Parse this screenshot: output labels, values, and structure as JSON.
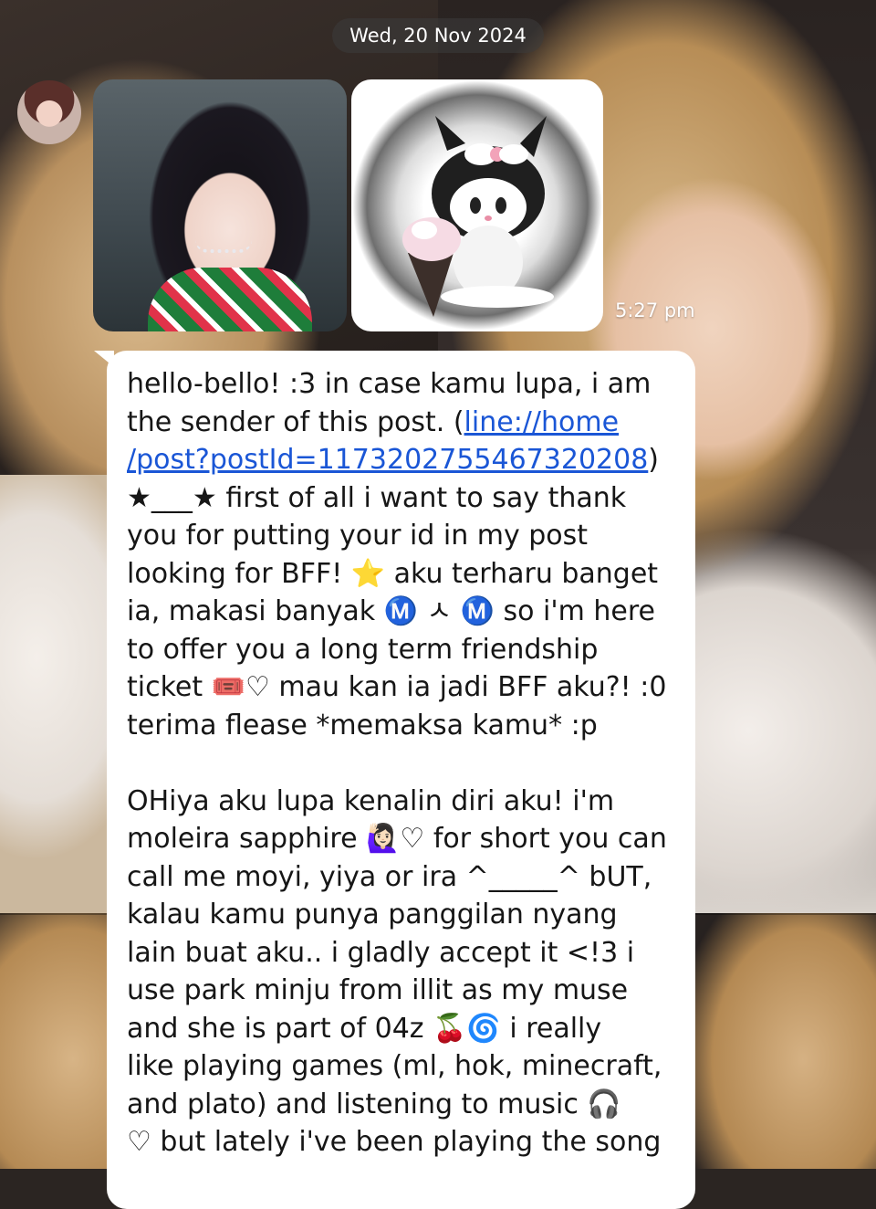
{
  "chat": {
    "date_label": "Wed, 20 Nov 2024",
    "message_time": "5:27 pm"
  },
  "message": {
    "line_1": "hello-bello! :3 in case kamu lupa, i am",
    "line_2_pre": "the sender of this post. (",
    "link_part_1": "line://home",
    "link_part_2": "/post?postId=1173202755467320208",
    "link_close": ")",
    "line_4": "★___★ first of all i want to say thank",
    "line_5": "you for putting your id in my post",
    "line_6": "looking for BFF! ⭐ aku terharu banget",
    "line_7": "ia, makasi banyak Ⓜ️ ㅅ Ⓜ️ so i'm here",
    "line_8": "to offer you a long term friendship",
    "line_9": "ticket 🎟️♡ mau kan ia jadi BFF aku?! :0",
    "line_10": "terima flease *memaksa kamu* :p",
    "line_11": "",
    "line_12": "OHiya aku lupa kenalin diri aku! i'm",
    "line_13": "moleira sapphire 🙋🏻‍♀️♡ for short you can",
    "line_14": "call me moyi, yiya or ira ^_____^ bUT,",
    "line_15": "kalau kamu punya panggilan nyang",
    "line_16": "lain buat aku.. i gladly accept it <!3 i",
    "line_17": "use park minju from illit as my muse",
    "line_18": "and she is part of 04z 🍒🌀 i really",
    "line_19": "like playing games (ml, hok, minecraft,",
    "line_20": "and plato) and listening to music 🎧",
    "line_21": "♡ but lately i've been playing the song"
  },
  "icons": {
    "avatar": "sender-avatar",
    "photo_1": "photo-girl-portrait",
    "photo_2": "kuromi-sticker"
  },
  "colors": {
    "link": "#1a56d6",
    "bubble": "#ffffff",
    "date_pill": "#4a4a4a"
  }
}
